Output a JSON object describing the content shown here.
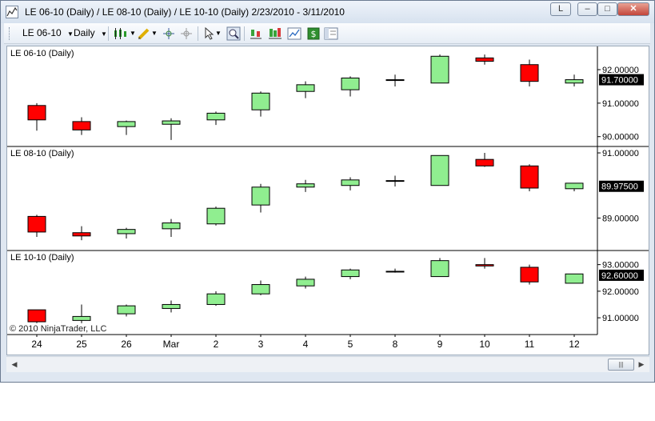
{
  "window": {
    "title": "LE 06-10 (Daily) / LE 08-10 (Daily) / LE 10-10 (Daily)  2/23/2010 - 3/11/2010",
    "buttons": {
      "link": "L",
      "minimize": "–",
      "maximize": "□",
      "close": "✕"
    }
  },
  "toolbar": {
    "instrument": "LE 06-10",
    "period": "Daily",
    "icons": [
      "candlestick-style-icon",
      "drawing-pencil-icon",
      "crosshair-icon",
      "global-crosshair-icon",
      "pointer-icon",
      "zoom-icon",
      "indicators-icon",
      "strategies-icon",
      "chart-data-icon",
      "dollar-icon",
      "properties-icon"
    ]
  },
  "copyright": "© 2010 NinjaTrader, LLC",
  "colors": {
    "up": "#90ee90",
    "down": "#ff0000",
    "wick": "#000000"
  },
  "chart_data": {
    "type": "candlestick",
    "categories": [
      "24",
      "25",
      "26",
      "Mar",
      "2",
      "3",
      "4",
      "5",
      "8",
      "9",
      "10",
      "11",
      "12"
    ],
    "panels": [
      {
        "name": "LE 06-10 (Daily)",
        "ylim": [
          89.85,
          92.55
        ],
        "ticks": [
          90.0,
          91.0,
          92.0
        ],
        "tick_labels": [
          "90.00000",
          "91.00000",
          "92.00000"
        ],
        "last_price": "91.70000",
        "candles": [
          {
            "o": 90.93,
            "h": 91.0,
            "l": 90.18,
            "c": 90.5
          },
          {
            "o": 90.45,
            "h": 90.58,
            "l": 90.05,
            "c": 90.2
          },
          {
            "o": 90.3,
            "h": 90.48,
            "l": 90.05,
            "c": 90.45
          },
          {
            "o": 90.37,
            "h": 90.55,
            "l": 89.9,
            "c": 90.47
          },
          {
            "o": 90.5,
            "h": 90.75,
            "l": 90.35,
            "c": 90.7
          },
          {
            "o": 90.8,
            "h": 91.35,
            "l": 90.6,
            "c": 91.3
          },
          {
            "o": 91.35,
            "h": 91.65,
            "l": 91.15,
            "c": 91.55
          },
          {
            "o": 91.4,
            "h": 91.8,
            "l": 91.2,
            "c": 91.75
          },
          {
            "o": 91.7,
            "h": 91.85,
            "l": 91.5,
            "c": 91.7
          },
          {
            "o": 91.6,
            "h": 92.45,
            "l": 91.6,
            "c": 92.4
          },
          {
            "o": 92.35,
            "h": 92.45,
            "l": 92.15,
            "c": 92.25
          },
          {
            "o": 92.15,
            "h": 92.3,
            "l": 91.5,
            "c": 91.65
          },
          {
            "o": 91.6,
            "h": 91.85,
            "l": 91.5,
            "c": 91.7
          }
        ]
      },
      {
        "name": "LE 08-10 (Daily)",
        "ylim": [
          88.15,
          91.05
        ],
        "ticks": [
          89.0,
          91.0
        ],
        "tick_labels": [
          "89.00000",
          "91.00000"
        ],
        "last_price": "89.97500",
        "candles": [
          {
            "o": 89.05,
            "h": 89.1,
            "l": 88.42,
            "c": 88.57
          },
          {
            "o": 88.55,
            "h": 88.75,
            "l": 88.32,
            "c": 88.45
          },
          {
            "o": 88.52,
            "h": 88.7,
            "l": 88.37,
            "c": 88.65
          },
          {
            "o": 88.67,
            "h": 88.97,
            "l": 88.42,
            "c": 88.85
          },
          {
            "o": 88.82,
            "h": 89.35,
            "l": 88.77,
            "c": 89.3
          },
          {
            "o": 89.4,
            "h": 90.05,
            "l": 89.17,
            "c": 89.95
          },
          {
            "o": 89.95,
            "h": 90.17,
            "l": 89.8,
            "c": 90.05
          },
          {
            "o": 90.0,
            "h": 90.25,
            "l": 89.85,
            "c": 90.17
          },
          {
            "o": 90.15,
            "h": 90.3,
            "l": 89.97,
            "c": 90.15
          },
          {
            "o": 90.0,
            "h": 90.92,
            "l": 90.0,
            "c": 90.92
          },
          {
            "o": 90.8,
            "h": 91.0,
            "l": 90.57,
            "c": 90.6
          },
          {
            "o": 90.6,
            "h": 90.65,
            "l": 89.82,
            "c": 89.92
          },
          {
            "o": 89.9,
            "h": 90.05,
            "l": 89.82,
            "c": 90.07
          }
        ]
      },
      {
        "name": "LE 10-10 (Daily)",
        "ylim": [
          90.55,
          93.35
        ],
        "ticks": [
          91.0,
          92.0,
          93.0
        ],
        "tick_labels": [
          "91.00000",
          "92.00000",
          "93.00000"
        ],
        "last_price": "92.60000",
        "candles": [
          {
            "o": 91.3,
            "h": 91.3,
            "l": 90.8,
            "c": 90.85
          },
          {
            "o": 90.9,
            "h": 91.5,
            "l": 90.8,
            "c": 91.05
          },
          {
            "o": 91.15,
            "h": 91.5,
            "l": 91.05,
            "c": 91.45
          },
          {
            "o": 91.35,
            "h": 91.65,
            "l": 91.2,
            "c": 91.5
          },
          {
            "o": 91.5,
            "h": 92.0,
            "l": 91.45,
            "c": 91.9
          },
          {
            "o": 91.9,
            "h": 92.4,
            "l": 91.85,
            "c": 92.25
          },
          {
            "o": 92.2,
            "h": 92.55,
            "l": 92.1,
            "c": 92.45
          },
          {
            "o": 92.55,
            "h": 92.85,
            "l": 92.45,
            "c": 92.8
          },
          {
            "o": 92.75,
            "h": 92.85,
            "l": 92.7,
            "c": 92.75
          },
          {
            "o": 92.55,
            "h": 93.25,
            "l": 92.55,
            "c": 93.15
          },
          {
            "o": 93.0,
            "h": 93.25,
            "l": 92.85,
            "c": 92.95
          },
          {
            "o": 92.9,
            "h": 93.0,
            "l": 92.25,
            "c": 92.35
          },
          {
            "o": 92.3,
            "h": 92.65,
            "l": 92.3,
            "c": 92.65
          }
        ]
      }
    ]
  }
}
